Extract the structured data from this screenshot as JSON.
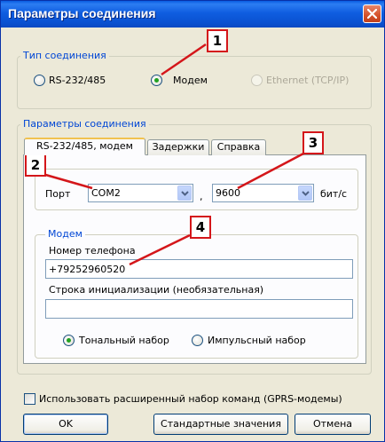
{
  "window": {
    "title": "Параметры соединения"
  },
  "connection_type": {
    "label": "Тип соединения",
    "options": [
      {
        "label": "RS-232/485",
        "selected": false,
        "enabled": true
      },
      {
        "label": "Модем",
        "selected": true,
        "enabled": true
      },
      {
        "label": "Ethernet (TCP/IP)",
        "selected": false,
        "enabled": false
      }
    ]
  },
  "connection_params": {
    "label": "Параметры соединения",
    "tabs": [
      {
        "label": "RS-232/485, модем",
        "active": true
      },
      {
        "label": "Задержки",
        "active": false
      },
      {
        "label": "Справка",
        "active": false
      }
    ],
    "port": {
      "label": "Порт",
      "value": "COM2",
      "separator": ",",
      "baud_value": "9600",
      "baud_unit": "бит/с"
    },
    "modem": {
      "label": "Модем",
      "phone_label": "Номер телефона",
      "phone_value": "+79252960520",
      "init_label": "Строка инициализации (необязательная)",
      "init_value": "",
      "dial_options": [
        {
          "label": "Тональный набор",
          "selected": true
        },
        {
          "label": "Импульсный набор",
          "selected": false
        }
      ]
    }
  },
  "extended_commands": {
    "label": "Использовать расширенный набор команд (GPRS-модемы)",
    "checked": false
  },
  "buttons": {
    "ok": "OK",
    "defaults": "Стандартные значения",
    "cancel": "Отмена"
  },
  "annotations": [
    "1",
    "2",
    "3",
    "4"
  ],
  "colors": {
    "annotation": "#d4161a",
    "titlebar": "#0a52d2",
    "group_label": "#0046d5",
    "radio_dot": "#21a121"
  }
}
